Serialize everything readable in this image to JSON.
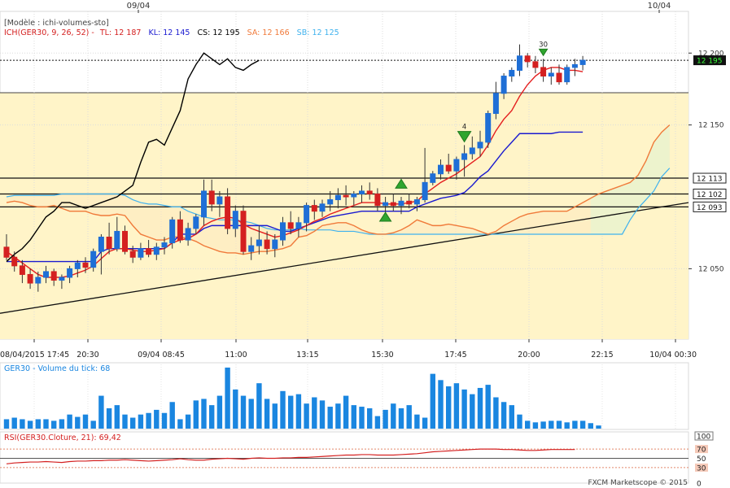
{
  "top_dates": [
    "09/04",
    "10/04"
  ],
  "header": {
    "model": "[Modèle : ichi-volumes-sto]",
    "ich_name": "ICH(GER30, 9, 26, 52) -",
    "tl": "TL: 12 187",
    "kl": "KL: 12 145",
    "cs": "CS: 12 195",
    "sa": "SA: 12 166",
    "sb": "SB: 12 125"
  },
  "colors": {
    "tenkan": "#e41e1e",
    "kijun": "#1a1ad0",
    "chikou": "#000000",
    "senkou_a": "#f07a3a",
    "senkou_b": "#3fb2ee",
    "cloud": "#fff4c8",
    "bull_candle": "#1f6fd6",
    "bear_candle": "#d42020",
    "volume": "#1a86e0",
    "rsi": "#d42020"
  },
  "price_axis": {
    "ticks": [
      "12 200",
      "12 150",
      "12 050"
    ],
    "tick_values": [
      12200,
      12150,
      12050
    ],
    "current_price": "12 195",
    "current_value": 12195,
    "levels": [
      {
        "label": "12 113",
        "value": 12113
      },
      {
        "label": "12 102",
        "value": 12102
      },
      {
        "label": "12 093",
        "value": 12093
      }
    ],
    "ylim": [
      12001,
      12229
    ]
  },
  "time_axis": [
    "08/04/2015 17:45",
    "20:30",
    "09/04 08:45",
    "11:00",
    "13:15",
    "15:30",
    "17:45",
    "20:00",
    "22:15",
    "10/04 00:30"
  ],
  "signals": [
    {
      "label": "4",
      "candle": 58,
      "direction": "down"
    },
    {
      "label": "30",
      "candle": 68,
      "direction": "down"
    }
  ],
  "volume_panel": {
    "label": "GER30 - Volume du tick: 68"
  },
  "rsi_panel": {
    "label": "RSI(GER30.Cloture, 21): 69,42",
    "ticks": [
      "100",
      "70",
      "50",
      "30",
      "0"
    ],
    "tick_values": [
      100,
      70,
      50,
      30,
      0
    ]
  },
  "footer": "FXCM Marketscope © 2015",
  "chart_data": {
    "type": "candlestick",
    "candles": [
      {
        "o": 12065,
        "h": 12074,
        "l": 12056,
        "c": 12058
      },
      {
        "o": 12058,
        "h": 12062,
        "l": 12048,
        "c": 12052
      },
      {
        "o": 12052,
        "h": 12056,
        "l": 12040,
        "c": 12046
      },
      {
        "o": 12046,
        "h": 12050,
        "l": 12036,
        "c": 12040
      },
      {
        "o": 12040,
        "h": 12048,
        "l": 12034,
        "c": 12044
      },
      {
        "o": 12044,
        "h": 12052,
        "l": 12040,
        "c": 12048
      },
      {
        "o": 12048,
        "h": 12050,
        "l": 12038,
        "c": 12042
      },
      {
        "o": 12042,
        "h": 12046,
        "l": 12036,
        "c": 12044
      },
      {
        "o": 12044,
        "h": 12052,
        "l": 12040,
        "c": 12050
      },
      {
        "o": 12050,
        "h": 12056,
        "l": 12044,
        "c": 12054
      },
      {
        "o": 12054,
        "h": 12058,
        "l": 12047,
        "c": 12051
      },
      {
        "o": 12051,
        "h": 12064,
        "l": 12048,
        "c": 12062
      },
      {
        "o": 12062,
        "h": 12074,
        "l": 12046,
        "c": 12072
      },
      {
        "o": 12072,
        "h": 12082,
        "l": 12060,
        "c": 12064
      },
      {
        "o": 12064,
        "h": 12086,
        "l": 12062,
        "c": 12076
      },
      {
        "o": 12076,
        "h": 12080,
        "l": 12060,
        "c": 12062
      },
      {
        "o": 12062,
        "h": 12066,
        "l": 12054,
        "c": 12058
      },
      {
        "o": 12058,
        "h": 12068,
        "l": 12056,
        "c": 12064
      },
      {
        "o": 12064,
        "h": 12070,
        "l": 12058,
        "c": 12060
      },
      {
        "o": 12060,
        "h": 12068,
        "l": 12056,
        "c": 12065
      },
      {
        "o": 12065,
        "h": 12072,
        "l": 12060,
        "c": 12068
      },
      {
        "o": 12068,
        "h": 12086,
        "l": 12064,
        "c": 12084
      },
      {
        "o": 12084,
        "h": 12090,
        "l": 12068,
        "c": 12070
      },
      {
        "o": 12070,
        "h": 12082,
        "l": 12066,
        "c": 12078
      },
      {
        "o": 12078,
        "h": 12088,
        "l": 12074,
        "c": 12086
      },
      {
        "o": 12086,
        "h": 12112,
        "l": 12080,
        "c": 12104
      },
      {
        "o": 12104,
        "h": 12112,
        "l": 12090,
        "c": 12095
      },
      {
        "o": 12095,
        "h": 12104,
        "l": 12086,
        "c": 12100
      },
      {
        "o": 12100,
        "h": 12106,
        "l": 12074,
        "c": 12078
      },
      {
        "o": 12078,
        "h": 12094,
        "l": 12072,
        "c": 12090
      },
      {
        "o": 12090,
        "h": 12094,
        "l": 12060,
        "c": 12062
      },
      {
        "o": 12062,
        "h": 12072,
        "l": 12056,
        "c": 12066
      },
      {
        "o": 12066,
        "h": 12080,
        "l": 12060,
        "c": 12070
      },
      {
        "o": 12070,
        "h": 12076,
        "l": 12060,
        "c": 12064
      },
      {
        "o": 12064,
        "h": 12074,
        "l": 12058,
        "c": 12070
      },
      {
        "o": 12070,
        "h": 12086,
        "l": 12066,
        "c": 12082
      },
      {
        "o": 12082,
        "h": 12090,
        "l": 12074,
        "c": 12078
      },
      {
        "o": 12078,
        "h": 12086,
        "l": 12072,
        "c": 12082
      },
      {
        "o": 12082,
        "h": 12096,
        "l": 12076,
        "c": 12094
      },
      {
        "o": 12094,
        "h": 12098,
        "l": 12084,
        "c": 12090
      },
      {
        "o": 12090,
        "h": 12098,
        "l": 12086,
        "c": 12095
      },
      {
        "o": 12095,
        "h": 12104,
        "l": 12090,
        "c": 12098
      },
      {
        "o": 12098,
        "h": 12106,
        "l": 12092,
        "c": 12101
      },
      {
        "o": 12101,
        "h": 12108,
        "l": 12094,
        "c": 12100
      },
      {
        "o": 12100,
        "h": 12104,
        "l": 12094,
        "c": 12102
      },
      {
        "o": 12102,
        "h": 12108,
        "l": 12096,
        "c": 12104
      },
      {
        "o": 12104,
        "h": 12110,
        "l": 12098,
        "c": 12102
      },
      {
        "o": 12102,
        "h": 12106,
        "l": 12090,
        "c": 12094
      },
      {
        "o": 12094,
        "h": 12100,
        "l": 12088,
        "c": 12096
      },
      {
        "o": 12096,
        "h": 12102,
        "l": 12090,
        "c": 12094
      },
      {
        "o": 12094,
        "h": 12100,
        "l": 12088,
        "c": 12097
      },
      {
        "o": 12097,
        "h": 12102,
        "l": 12092,
        "c": 12095
      },
      {
        "o": 12095,
        "h": 12100,
        "l": 12090,
        "c": 12098
      },
      {
        "o": 12098,
        "h": 12134,
        "l": 12096,
        "c": 12110
      },
      {
        "o": 12110,
        "h": 12118,
        "l": 12108,
        "c": 12116
      },
      {
        "o": 12116,
        "h": 12126,
        "l": 12112,
        "c": 12122
      },
      {
        "o": 12122,
        "h": 12130,
        "l": 12116,
        "c": 12118
      },
      {
        "o": 12118,
        "h": 12128,
        "l": 12112,
        "c": 12126
      },
      {
        "o": 12126,
        "h": 12136,
        "l": 12114,
        "c": 12130
      },
      {
        "o": 12130,
        "h": 12142,
        "l": 12126,
        "c": 12134
      },
      {
        "o": 12134,
        "h": 12146,
        "l": 12128,
        "c": 12138
      },
      {
        "o": 12138,
        "h": 12160,
        "l": 12134,
        "c": 12158
      },
      {
        "o": 12158,
        "h": 12180,
        "l": 12154,
        "c": 12172
      },
      {
        "o": 12172,
        "h": 12186,
        "l": 12168,
        "c": 12184
      },
      {
        "o": 12184,
        "h": 12190,
        "l": 12180,
        "c": 12188
      },
      {
        "o": 12188,
        "h": 12206,
        "l": 12184,
        "c": 12198
      },
      {
        "o": 12198,
        "h": 12200,
        "l": 12190,
        "c": 12194
      },
      {
        "o": 12194,
        "h": 12198,
        "l": 12186,
        "c": 12190
      },
      {
        "o": 12190,
        "h": 12196,
        "l": 12180,
        "c": 12184
      },
      {
        "o": 12184,
        "h": 12190,
        "l": 12178,
        "c": 12186
      },
      {
        "o": 12186,
        "h": 12192,
        "l": 12178,
        "c": 12180
      },
      {
        "o": 12180,
        "h": 12192,
        "l": 12178,
        "c": 12190
      },
      {
        "o": 12190,
        "h": 12196,
        "l": 12184,
        "c": 12192
      },
      {
        "o": 12192,
        "h": 12198,
        "l": 12188,
        "c": 12195
      }
    ],
    "tenkan": [
      12062,
      12058,
      12054,
      12050,
      12046,
      12044,
      12044,
      12044,
      12045,
      12047,
      12049,
      12052,
      12057,
      12062,
      12064,
      12064,
      12063,
      12062,
      12062,
      12063,
      12064,
      12068,
      12070,
      12071,
      12074,
      12080,
      12083,
      12085,
      12086,
      12085,
      12081,
      12078,
      12076,
      12074,
      12072,
      12073,
      12075,
      12077,
      12080,
      12083,
      12085,
      12088,
      12090,
      12092,
      12094,
      12096,
      12096,
      12096,
      12095,
      12095,
      12095,
      12096,
      12097,
      12102,
      12106,
      12110,
      12113,
      12116,
      12120,
      12124,
      12128,
      12136,
      12146,
      12154,
      12160,
      12170,
      12178,
      12184,
      12188,
      12190,
      12190,
      12188,
      12188,
      12187
    ],
    "kijun": [
      12055,
      12055,
      12055,
      12055,
      12055,
      12055,
      12055,
      12055,
      12055,
      12055,
      12055,
      12055,
      12062,
      12064,
      12064,
      12064,
      12064,
      12064,
      12064,
      12064,
      12064,
      12068,
      12074,
      12074,
      12074,
      12078,
      12080,
      12080,
      12080,
      12080,
      12080,
      12080,
      12080,
      12080,
      12078,
      12076,
      12076,
      12078,
      12080,
      12082,
      12084,
      12086,
      12087,
      12088,
      12089,
      12090,
      12090,
      12090,
      12090,
      12090,
      12090,
      12090,
      12093,
      12095,
      12097,
      12099,
      12100,
      12101,
      12103,
      12108,
      12114,
      12118,
      12125,
      12132,
      12138,
      12144,
      12144,
      12144,
      12144,
      12144,
      12145,
      12145,
      12145,
      12145
    ],
    "chikou": [
      12055,
      12060,
      12064,
      12070,
      12078,
      12086,
      12090,
      12096,
      12096,
      12094,
      12092,
      12094,
      12096,
      12098,
      12100,
      12104,
      12108,
      12124,
      12138,
      12140,
      12136,
      12148,
      12160,
      12182,
      12192,
      12200,
      12196,
      12192,
      12196,
      12190,
      12188,
      12192,
      12195
    ],
    "senkou_a": [
      12096,
      12097,
      12096,
      12094,
      12093,
      12093,
      12094,
      12092,
      12090,
      12090,
      12090,
      12088,
      12087,
      12087,
      12088,
      12087,
      12080,
      12074,
      12072,
      12070,
      12070,
      12072,
      12072,
      12071,
      12069,
      12066,
      12064,
      12062,
      12061,
      12061,
      12060,
      12061,
      12062,
      12062,
      12063,
      12064,
      12066,
      12072,
      12073,
      12076,
      12080,
      12081,
      12082,
      12082,
      12080,
      12077,
      12075,
      12074,
      12074,
      12075,
      12077,
      12080,
      12084,
      12082,
      12080,
      12080,
      12081,
      12080,
      12079,
      12078,
      12076,
      12074,
      12076,
      12080,
      12083,
      12086,
      12088,
      12089,
      12090,
      12090,
      12090,
      12090,
      12093,
      12096,
      12099,
      12102,
      12104,
      12106,
      12108,
      12110,
      12115,
      12125,
      12138,
      12145,
      12150
    ],
    "senkou_b": [
      12100,
      12101,
      12101,
      12101,
      12101,
      12101,
      12101,
      12102,
      12102,
      12102,
      12102,
      12102,
      12102,
      12102,
      12102,
      12101,
      12098,
      12096,
      12095,
      12095,
      12094,
      12093,
      12093,
      12090,
      12088,
      12086,
      12085,
      12084,
      12084,
      12084,
      12083,
      12082,
      12080,
      12078,
      12077,
      12077,
      12077,
      12078,
      12077,
      12077,
      12077,
      12077,
      12076,
      12076,
      12076,
      12075,
      12074,
      12074,
      12074,
      12074,
      12074,
      12074,
      12074,
      12074,
      12074,
      12074,
      12074,
      12074,
      12074,
      12074,
      12074,
      12074,
      12074,
      12074,
      12074,
      12074,
      12074,
      12074,
      12074,
      12074,
      12074,
      12074,
      12074,
      12074,
      12074,
      12074,
      12074,
      12074,
      12074,
      12084,
      12092,
      12098,
      12104,
      12114,
      12120
    ],
    "volume": [
      12,
      14,
      12,
      10,
      12,
      12,
      10,
      12,
      18,
      15,
      18,
      10,
      42,
      26,
      30,
      18,
      14,
      18,
      20,
      24,
      20,
      34,
      12,
      18,
      36,
      38,
      30,
      42,
      78,
      50,
      42,
      38,
      58,
      38,
      32,
      48,
      42,
      44,
      32,
      40,
      36,
      28,
      32,
      42,
      30,
      28,
      26,
      16,
      24,
      32,
      26,
      30,
      18,
      14,
      70,
      62,
      54,
      58,
      50,
      44,
      52,
      56,
      40,
      34,
      30,
      18,
      10,
      8,
      9,
      10,
      10,
      8,
      10,
      10,
      7,
      4
    ],
    "rsi": [
      38,
      40,
      41,
      42,
      42,
      43,
      42,
      41,
      43,
      44,
      44,
      45,
      45,
      46,
      46,
      47,
      46,
      45,
      44,
      45,
      46,
      47,
      49,
      47,
      46,
      46,
      48,
      49,
      50,
      49,
      48,
      50,
      51,
      50,
      50,
      51,
      51,
      52,
      52,
      53,
      54,
      55,
      56,
      57,
      57,
      58,
      58,
      57,
      57,
      57,
      58,
      59,
      60,
      62,
      64,
      65,
      66,
      67,
      68,
      69,
      70,
      70,
      70,
      69,
      69,
      68,
      67,
      67,
      68,
      69,
      69,
      69,
      69
    ]
  }
}
